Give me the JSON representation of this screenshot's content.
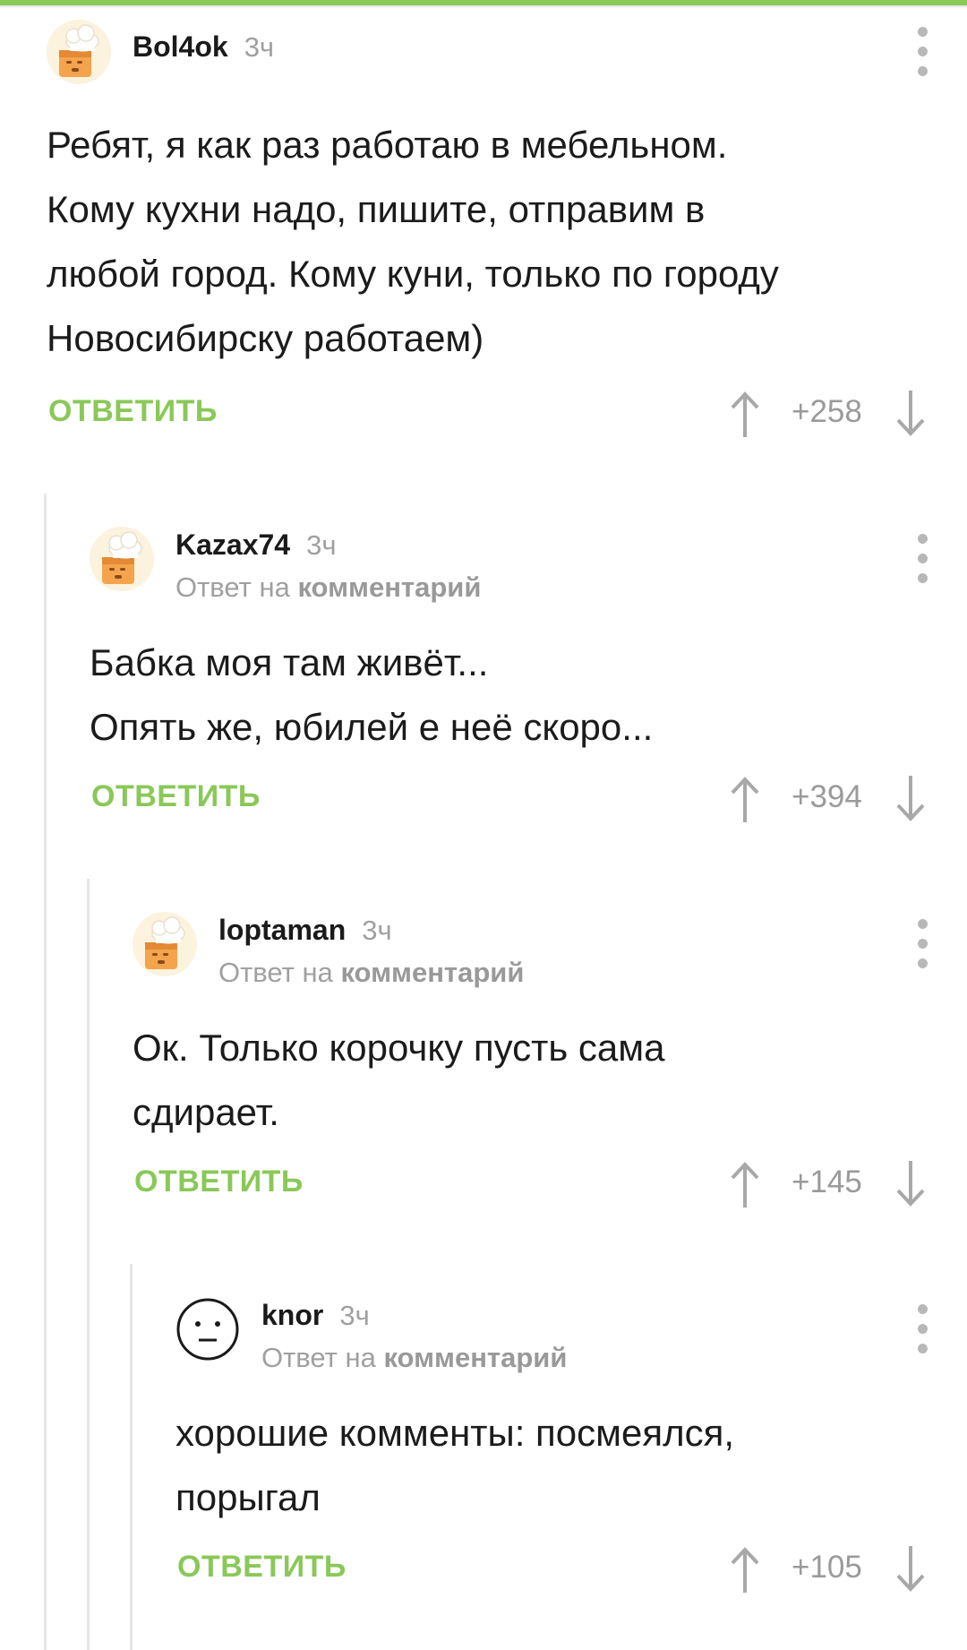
{
  "comments": [
    {
      "author": "Bol4ok",
      "time": "3ч",
      "avatar_icon": "default-baker-avatar",
      "reply_to_prefix": "",
      "reply_to_target": "",
      "lines": [
        "Ребят, я как раз работаю в мебельном.",
        "Кому кухни надо, пишите, отправим в",
        "любой город. Кому куни, только по городу",
        "Новосибирску работаем)"
      ],
      "reply_label": "ОТВЕТИТЬ",
      "rating": "+258"
    },
    {
      "author": "Kazax74",
      "time": "3ч",
      "avatar_icon": "default-baker-avatar",
      "reply_to_prefix": "Ответ на",
      "reply_to_target": "комментарий",
      "lines": [
        "Бабка моя там живёт...",
        "Опять же, юбилей е неё скоро..."
      ],
      "reply_label": "ОТВЕТИТЬ",
      "rating": "+394"
    },
    {
      "author": "loptaman",
      "time": "3ч",
      "avatar_icon": "default-baker-avatar",
      "reply_to_prefix": "Ответ на",
      "reply_to_target": "комментарий",
      "lines": [
        "Ок. Только корочку пусть сама",
        "сдирает."
      ],
      "reply_label": "ОТВЕТИТЬ",
      "rating": "+145"
    },
    {
      "author": "knor",
      "time": "3ч",
      "avatar_icon": "neutral-face-avatar",
      "reply_to_prefix": "Ответ на",
      "reply_to_target": "комментарий",
      "lines": [
        "хорошие комменты: посмеялся,",
        "порыгал"
      ],
      "reply_label": "ОТВЕТИТЬ",
      "rating": "+105"
    }
  ],
  "colors": {
    "accent": "#8ac858",
    "muted": "#a0a0a0",
    "thread_line": "#e6e6e6"
  },
  "icons": {
    "more": "more-vertical-icon",
    "upvote": "arrow-up-icon",
    "downvote": "arrow-down-icon"
  }
}
